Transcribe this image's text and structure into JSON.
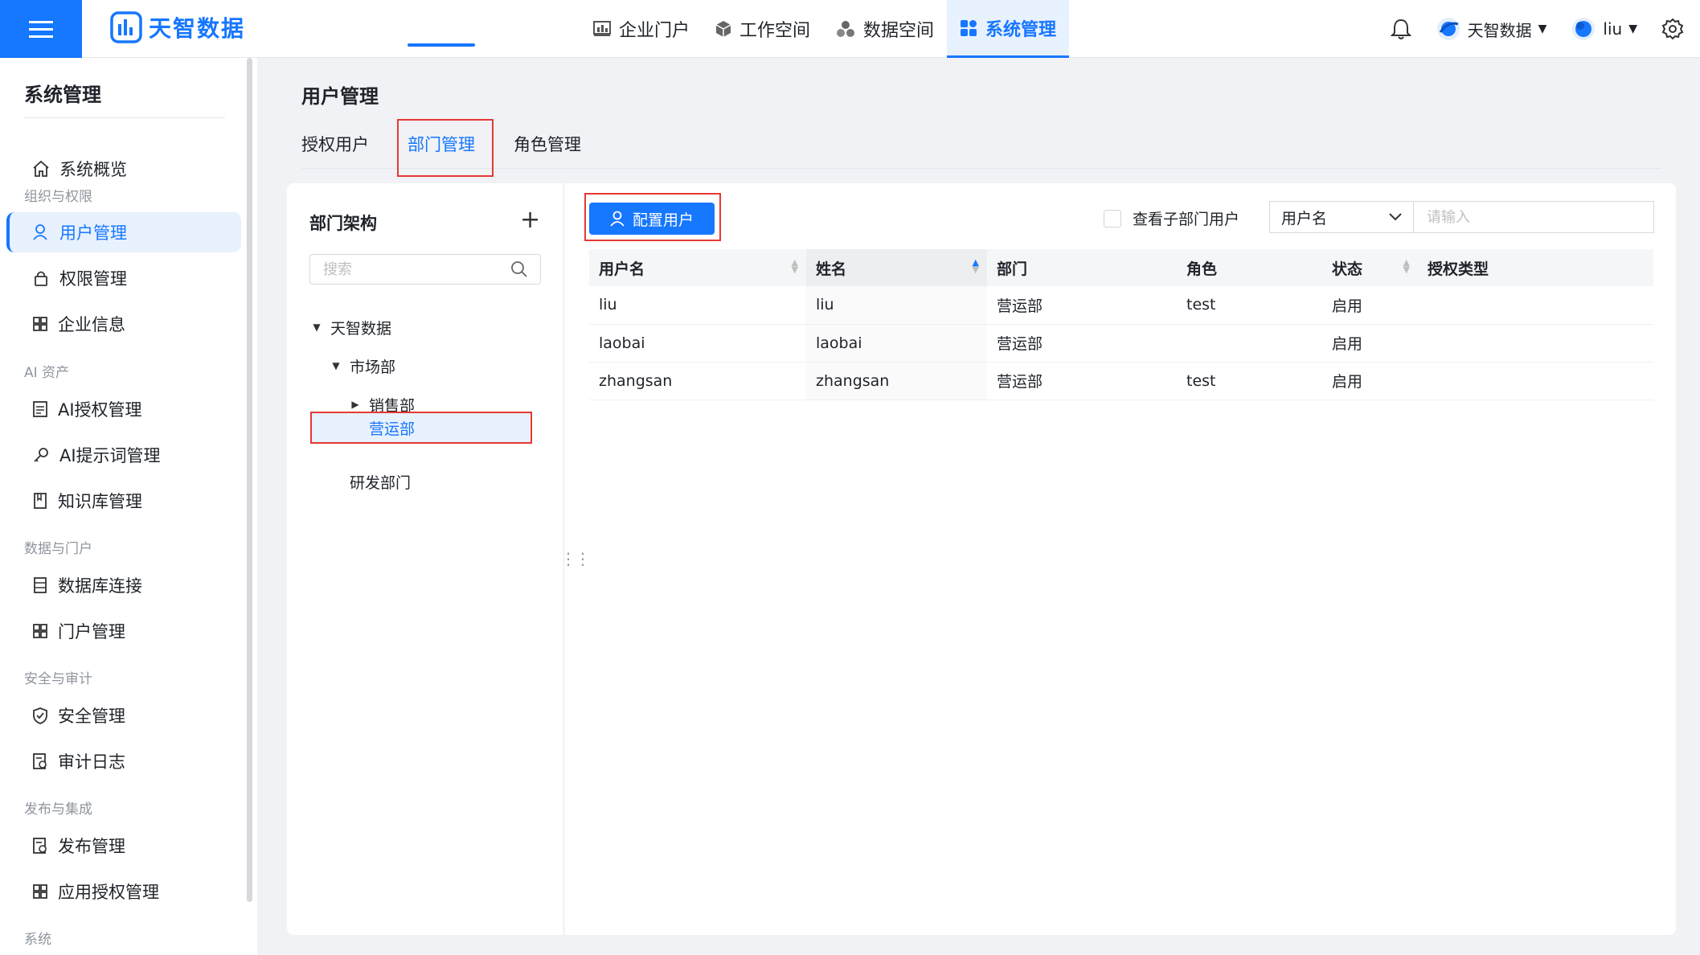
{
  "colors": {
    "primary": "#1677ff",
    "highlight": "#e53935"
  },
  "header": {
    "brand": "天智数据",
    "nav": [
      {
        "label": "企业门户",
        "icon": "chart-icon"
      },
      {
        "label": "工作空间",
        "icon": "cube-icon"
      },
      {
        "label": "数据空间",
        "icon": "cluster-icon"
      },
      {
        "label": "系统管理",
        "icon": "grid-icon",
        "active": true
      }
    ],
    "org_name": "天智数据",
    "user_name": "liu"
  },
  "sidebar": {
    "title": "系统管理",
    "overview": "系统概览",
    "groups": [
      {
        "label": "组织与权限",
        "items": [
          "用户管理",
          "权限管理",
          "企业信息"
        ]
      },
      {
        "label": "AI 资产",
        "items": [
          "AI授权管理",
          "AI提示词管理",
          "知识库管理"
        ]
      },
      {
        "label": "数据与门户",
        "items": [
          "数据库连接",
          "门户管理"
        ]
      },
      {
        "label": "安全与审计",
        "items": [
          "安全管理",
          "审计日志"
        ]
      },
      {
        "label": "发布与集成",
        "items": [
          "发布管理",
          "应用授权管理"
        ]
      },
      {
        "label": "系统",
        "items": []
      }
    ]
  },
  "main": {
    "title": "用户管理",
    "tabs": [
      "授权用户",
      "部门管理",
      "角色管理"
    ],
    "active_tab": "部门管理"
  },
  "tree": {
    "title": "部门架构",
    "search_placeholder": "搜索",
    "nodes": [
      "天智数据",
      "市场部",
      "销售部",
      "营运部",
      "研发部门"
    ],
    "selected": "营运部"
  },
  "toolbar": {
    "config_button": "配置用户",
    "sub_dept_checkbox": "查看子部门用户",
    "filter_field": "用户名",
    "filter_placeholder": "请输入"
  },
  "table": {
    "columns": [
      "用户名",
      "姓名",
      "部门",
      "角色",
      "状态",
      "授权类型"
    ],
    "rows": [
      [
        "liu",
        "liu",
        "营运部",
        "test",
        "启用",
        ""
      ],
      [
        "laobai",
        "laobai",
        "营运部",
        "",
        "启用",
        ""
      ],
      [
        "zhangsan",
        "zhangsan",
        "营运部",
        "test",
        "启用",
        ""
      ]
    ]
  }
}
